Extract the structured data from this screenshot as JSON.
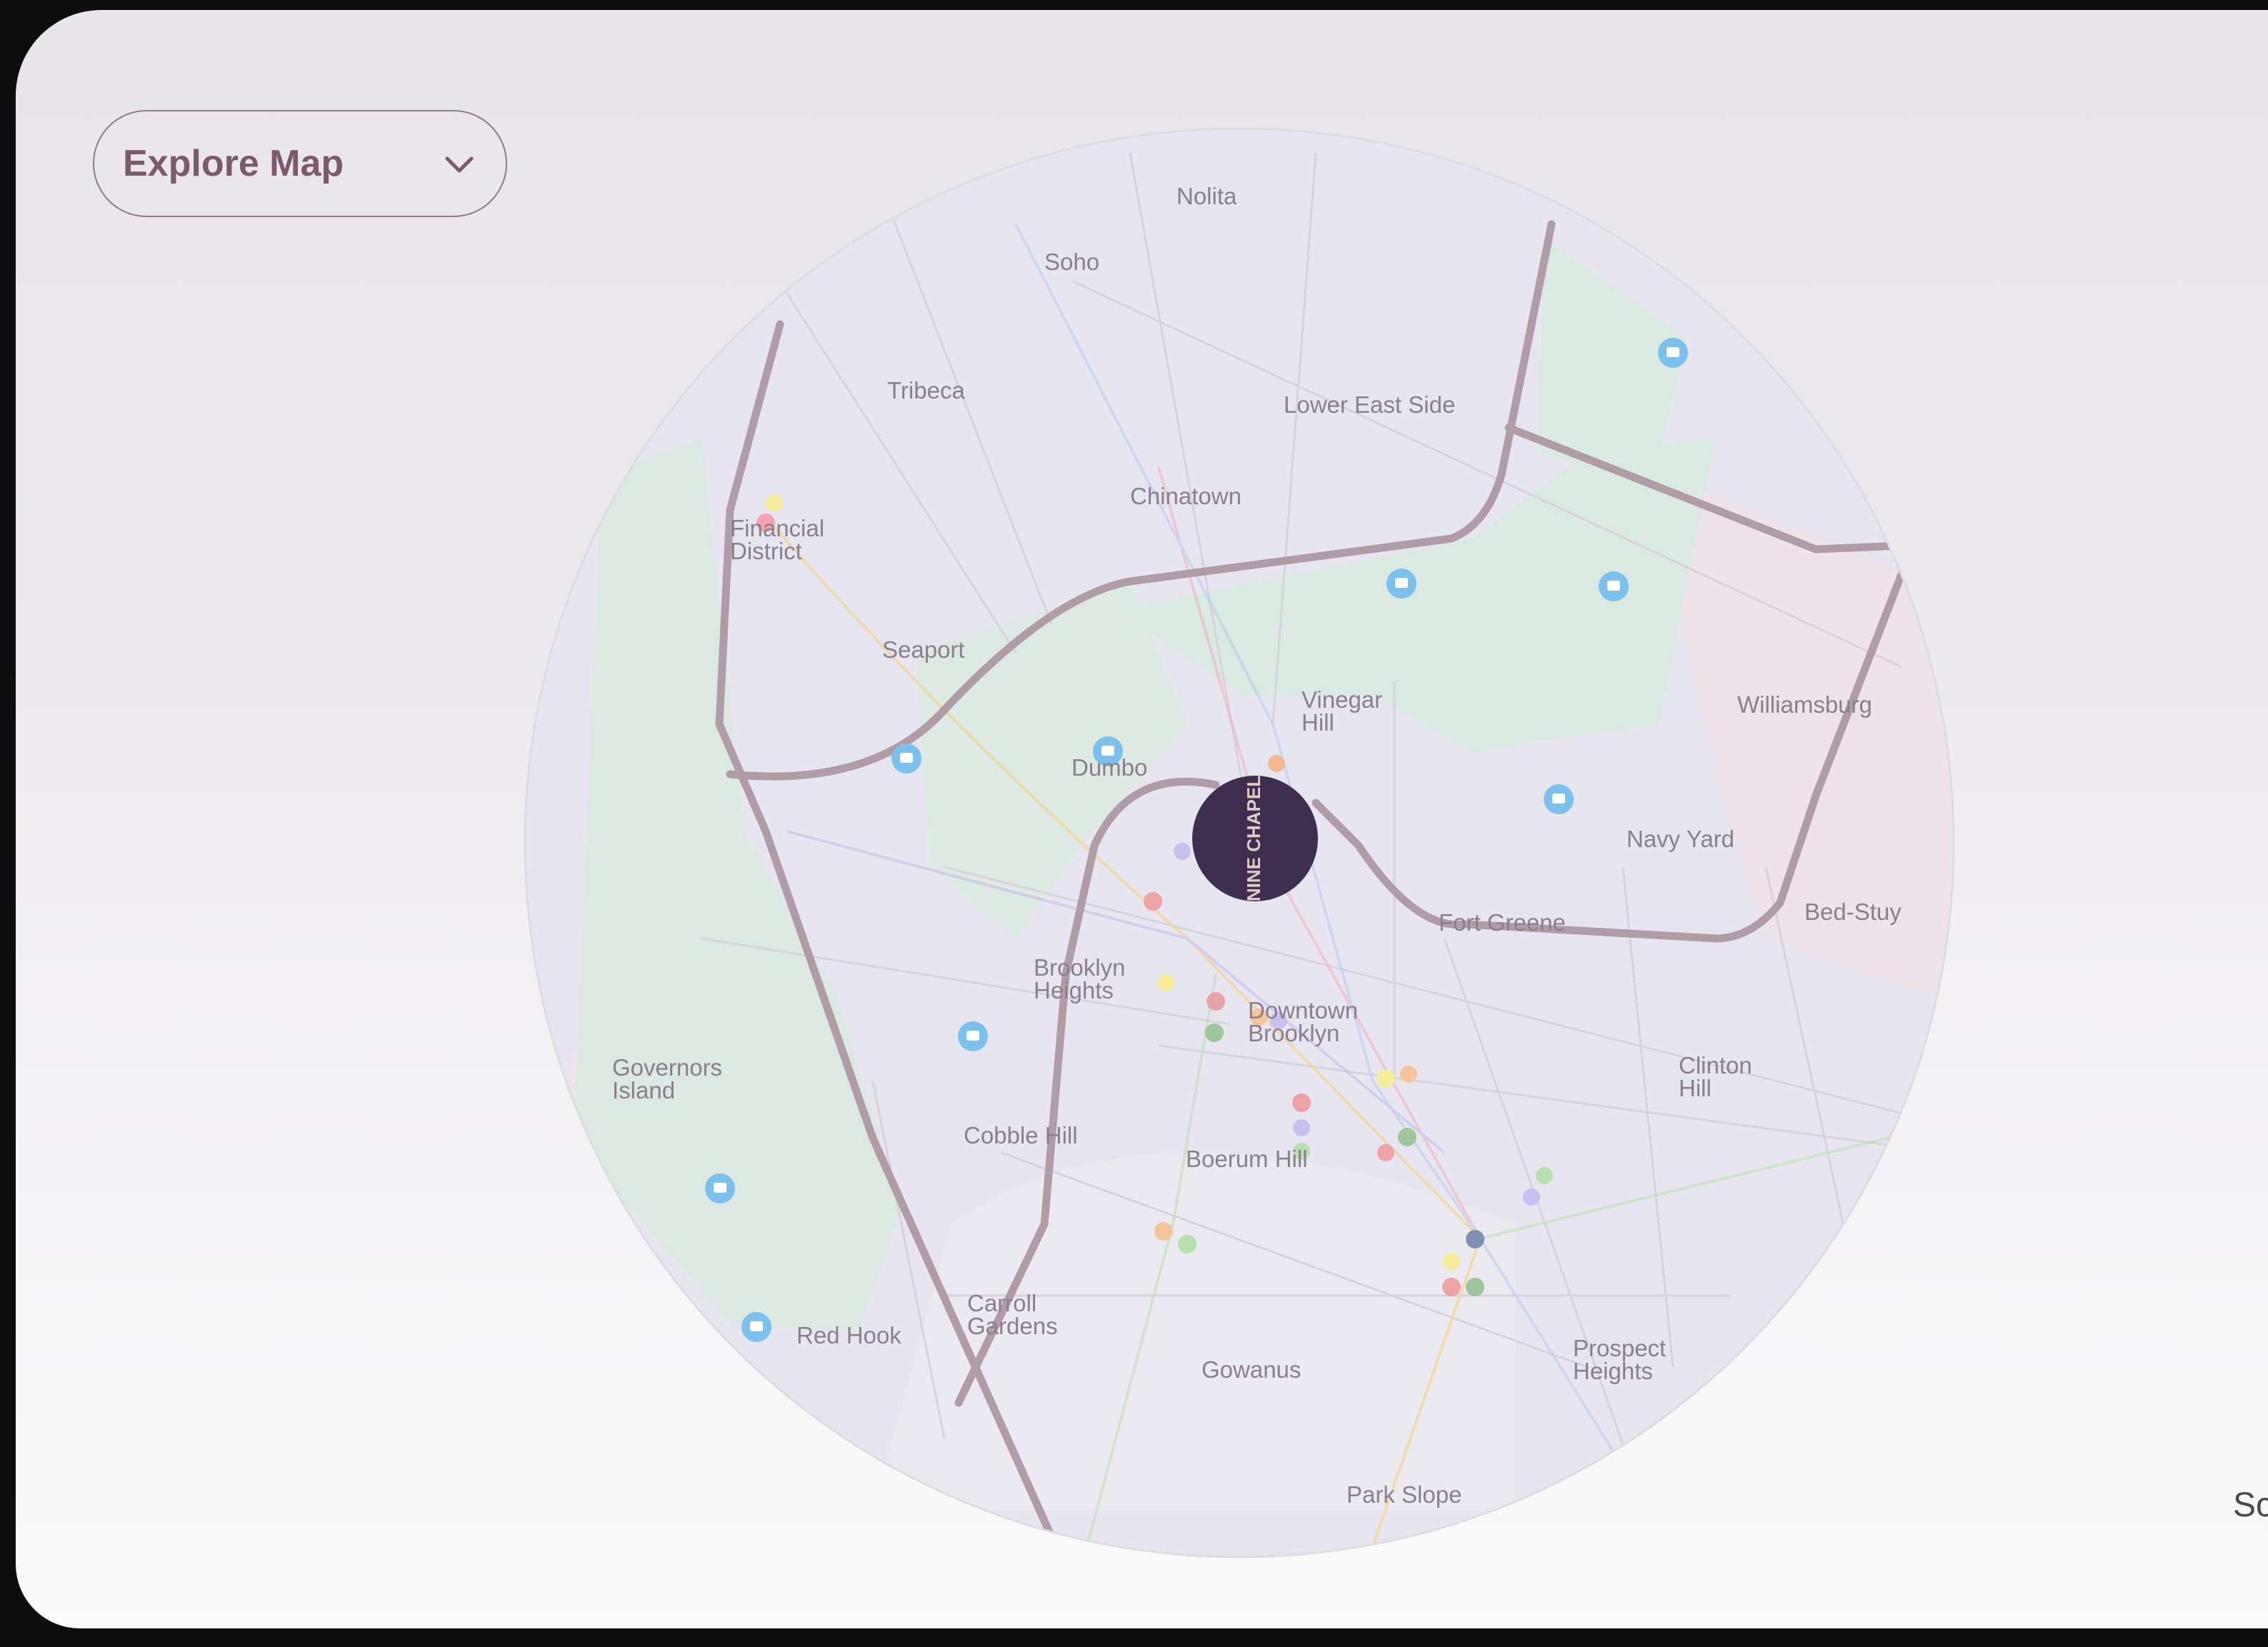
{
  "controls": {
    "explore_label": "Explore Map",
    "chevron_icon": "chevron-down-icon"
  },
  "brand": {
    "logo_text": "NINE CHAPEL",
    "logo_color": "#3e2f50"
  },
  "neighborhoods": [
    "Nolita",
    "Soho",
    "Tribeca",
    "Lower East Side",
    "Chinatown",
    "Financial District",
    "Seaport",
    "Vinegar Hill",
    "Dumbo",
    "Williamsburg",
    "Navy Yard",
    "Bed-Stuy",
    "Fort Greene",
    "Brooklyn Heights",
    "Downtown Brooklyn",
    "Governors Island",
    "Clinton Hill",
    "Cobble Hill",
    "Boerum Hill",
    "Carroll Gardens",
    "Red Hook",
    "Gowanus",
    "Prospect Heights",
    "Park Slope"
  ],
  "footer": {
    "text": "Sc"
  },
  "colors": {
    "water": "#f0e4e9",
    "park": "#dce9e2",
    "land": "#e7e6f0",
    "highway": "#b09ca6",
    "transit_icon": "#7cc0ee"
  }
}
